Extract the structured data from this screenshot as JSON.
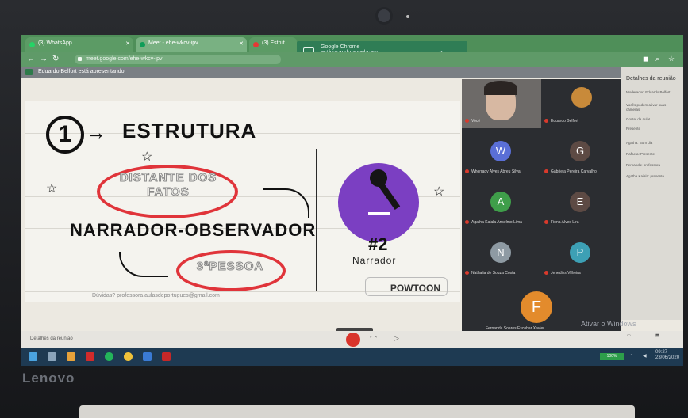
{
  "browser": {
    "tabs": [
      {
        "label": "(3) WhatsApp"
      },
      {
        "label": "Meet - ehe-wkcv-ipv"
      },
      {
        "label": "(3) Estrut..."
      }
    ],
    "url": "meet.google.com/ehe-wkcv-ipv",
    "notification": {
      "title": "Google Chrome",
      "text": "está usando a webcam"
    }
  },
  "meet": {
    "presenting_text": "Eduardo Belfort está apresentando",
    "meeting_label": "Detalhes da reunião",
    "watermark": "Ativar o Windows"
  },
  "slide": {
    "number": "1",
    "heading": "ESTRUTURA",
    "oval_top": "DISTANTE DOS FATOS",
    "main_phrase": "NARRADOR-OBSERVADOR",
    "oval_bottom": "3ªPESSOA",
    "badge_number": "#2",
    "badge_label": "Narrador",
    "email": "Dúvidas? professora.aulasdeportugues@gmail.com",
    "powtoon": "POWTOON"
  },
  "participants": [
    {
      "name": "Você",
      "initial": "",
      "color": "#6d6a68"
    },
    {
      "name": "Eduardo Belfort",
      "initial": "",
      "color": "#c88a3a"
    },
    {
      "name": "Wherrady Alves Abreu Silva",
      "initial": "W",
      "color": "#5a6fd6"
    },
    {
      "name": "Gabriela Pereira Carvalho",
      "initial": "G",
      "color": "#5d4a44"
    },
    {
      "name": "Agatha Kaiala Anselmo Lima",
      "initial": "A",
      "color": "#3f9e4a"
    },
    {
      "name": "Fiona Alves Lira",
      "initial": "E",
      "color": "#5d4a44"
    },
    {
      "name": "Nathalia de Souza Costa",
      "initial": "N",
      "color": "#8e9aa3"
    },
    {
      "name": "Jenedivs Vilheira",
      "initial": "P",
      "color": "#3da0b5"
    }
  ],
  "featured": {
    "name": "Fernanda Soares Escobar Xavier",
    "initial": "F",
    "color": "#e38b2c"
  },
  "panel": {
    "title": "Detalhes da reunião",
    "lines": [
      "Moderador: Eduardo Belfort",
      "Vocês podem ativar suas câmeras",
      "Gostei da aula!",
      "Presente",
      "Agatha: Bom dia",
      "Rafaela: Presente",
      "Fernanda: professora",
      "Agatha Kaiala: presente"
    ]
  },
  "taskbar": {
    "battery": "100%",
    "time": "09:27",
    "date": "23/06/2020"
  }
}
